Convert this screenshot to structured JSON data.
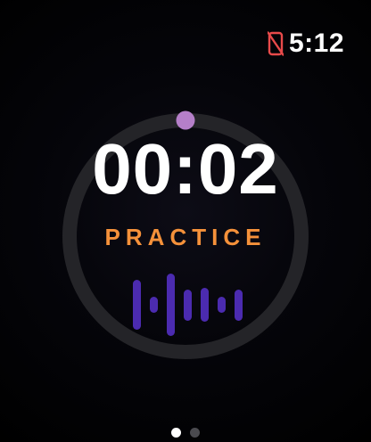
{
  "status_bar": {
    "time": "5:12",
    "icon": "phone-disconnected-icon",
    "icon_color": "#e84a4a"
  },
  "timer": {
    "elapsed": "00:02",
    "progress": 0.0
  },
  "mode": {
    "label": "PRACTICE",
    "color": "#f5913a"
  },
  "colors": {
    "ring_track": "#242428",
    "ring_knob": "#b57fc9",
    "waveform": "#4b2bb0",
    "dot_active": "#ffffff",
    "dot_inactive": "#4a4a4f"
  },
  "waveform": {
    "icon": "audio-waveform-icon",
    "bar_levels": [
      0.8,
      0.25,
      1.0,
      0.5,
      0.55,
      0.25,
      0.5
    ]
  },
  "page_indicator": {
    "count": 2,
    "active_index": 0
  }
}
